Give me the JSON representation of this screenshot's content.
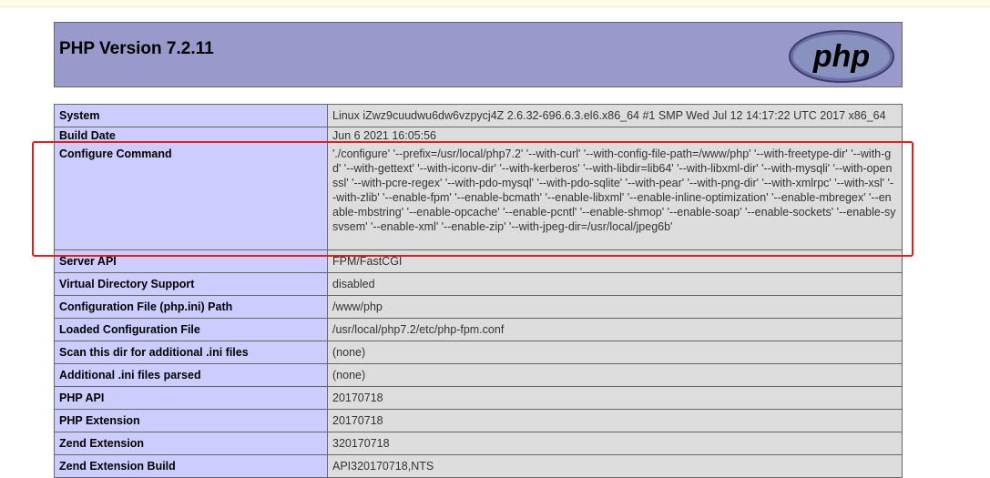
{
  "header": {
    "title": "PHP Version 7.2.11",
    "logo_text": "php"
  },
  "rows": [
    {
      "label": "System",
      "value": "Linux iZwz9cuudwu6dw6vzpycj4Z 2.6.32-696.6.3.el6.x86_64 #1 SMP Wed Jul 12 14:17:22 UTC 2017 x86_64"
    },
    {
      "label": "Build Date",
      "value": "Jun 6 2021 16:05:56"
    },
    {
      "label": "Configure Command",
      "value": "'./configure' '--prefix=/usr/local/php7.2' '--with-curl' '--with-config-file-path=/www/php' '--with-freetype-dir' '--with-gd' '--with-gettext' '--with-iconv-dir' '--with-kerberos' '--with-libdir=lib64' '--with-libxml-dir' '--with-mysqli' '--with-openssl' '--with-pcre-regex' '--with-pdo-mysql' '--with-pdo-sqlite' '--with-pear' '--with-png-dir' '--with-xmlrpc' '--with-xsl' '--with-zlib' '--enable-fpm' '--enable-bcmath' '--enable-libxml' '--enable-inline-optimization' '--enable-mbregex' '--enable-mbstring' '--enable-opcache' '--enable-pcntl' '--enable-shmop' '--enable-soap' '--enable-sockets' '--enable-sysvsem' '--enable-xml' '--enable-zip' '--with-jpeg-dir=/usr/local/jpeg6b'"
    },
    {
      "label": "Server API",
      "value": "FPM/FastCGI"
    },
    {
      "label": "Virtual Directory Support",
      "value": "disabled"
    },
    {
      "label": "Configuration File (php.ini) Path",
      "value": "/www/php"
    },
    {
      "label": "Loaded Configuration File",
      "value": "/usr/local/php7.2/etc/php-fpm.conf"
    },
    {
      "label": "Scan this dir for additional .ini files",
      "value": "(none)"
    },
    {
      "label": "Additional .ini files parsed",
      "value": "(none)"
    },
    {
      "label": "PHP API",
      "value": "20170718"
    },
    {
      "label": "PHP Extension",
      "value": "20170718"
    },
    {
      "label": "Zend Extension",
      "value": "320170718"
    },
    {
      "label": "Zend Extension Build",
      "value": "API320170718,NTS"
    }
  ],
  "colors": {
    "header_bg": "#9999cc",
    "label_bg": "#ccccff",
    "value_bg": "#dddddd",
    "highlight": "#e02020"
  }
}
